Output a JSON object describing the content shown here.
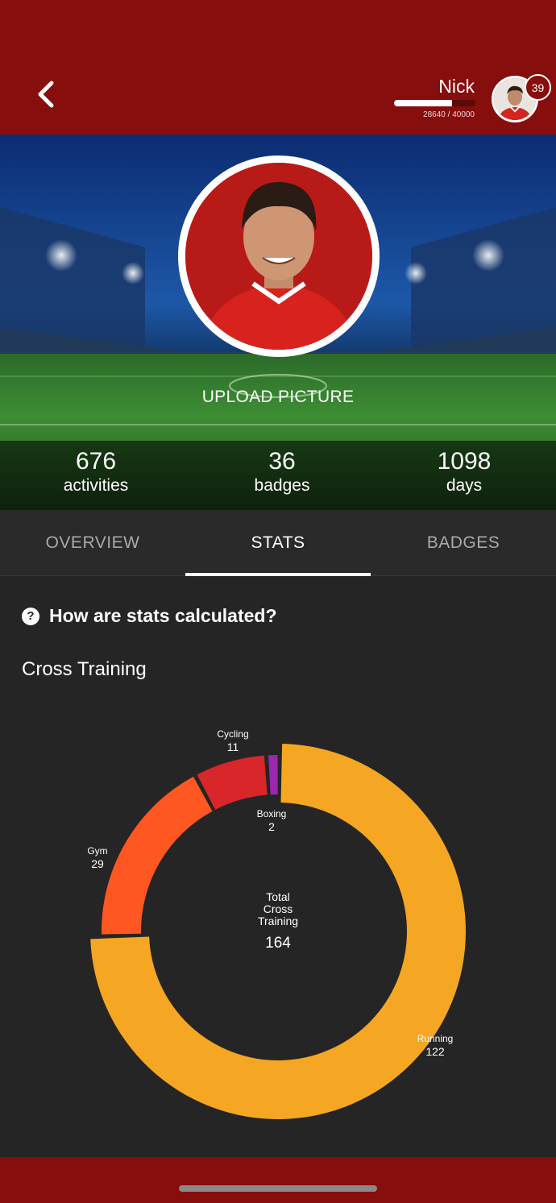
{
  "header": {
    "user_name": "Nick",
    "xp_text": "28640 / 40000",
    "xp_progress": 0.716,
    "level": "39"
  },
  "hero": {
    "upload_label": "UPLOAD PICTURE",
    "stats": [
      {
        "value": "676",
        "label": "activities"
      },
      {
        "value": "36",
        "label": "badges"
      },
      {
        "value": "1098",
        "label": "days"
      }
    ]
  },
  "tabs": [
    {
      "label": "OVERVIEW",
      "active": false
    },
    {
      "label": "STATS",
      "active": true
    },
    {
      "label": "BADGES",
      "active": false
    }
  ],
  "help": {
    "label": "How are stats calculated?",
    "icon": "question-circle-icon"
  },
  "section": {
    "title": "Cross Training"
  },
  "colors": {
    "brand": "#860e0c",
    "background": "#252525"
  },
  "chart_data": {
    "type": "pie",
    "donut": true,
    "center_label": [
      "Total",
      "Cross",
      "Training"
    ],
    "center_value": "164",
    "slices": [
      {
        "label": "Running",
        "value": 122,
        "color": "#f5a623"
      },
      {
        "label": "Gym",
        "value": 29,
        "color": "#fe5722"
      },
      {
        "label": "Cycling",
        "value": 11,
        "color": "#d9262a"
      },
      {
        "label": "Boxing",
        "value": 2,
        "color": "#9b27b0"
      }
    ]
  }
}
